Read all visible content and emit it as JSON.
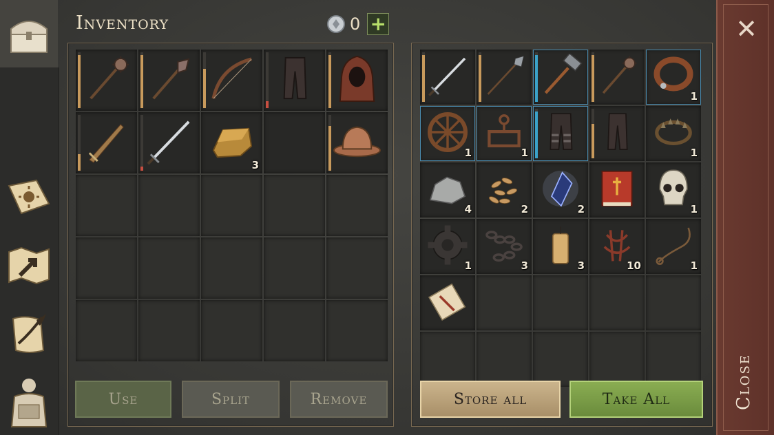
{
  "header": {
    "title": "Inventory",
    "currency_count": "0",
    "add_label": "+"
  },
  "sidebar": {
    "items": [
      {
        "icon": "chest-icon"
      },
      {
        "icon": "sun-book-icon"
      },
      {
        "icon": "map-icon"
      },
      {
        "icon": "scroll-quill-icon"
      },
      {
        "icon": "character-backpack-icon"
      }
    ]
  },
  "inventory": {
    "slots": [
      {
        "item": "mace-icon",
        "count": ""
      },
      {
        "item": "flanged-mace-icon",
        "count": ""
      },
      {
        "item": "bow-icon",
        "count": ""
      },
      {
        "item": "leather-pants-icon",
        "count": ""
      },
      {
        "item": "hood-icon",
        "count": ""
      },
      {
        "item": "short-sword-icon",
        "count": ""
      },
      {
        "item": "long-sword-icon",
        "count": ""
      },
      {
        "item": "gold-ingot-icon",
        "count": "3"
      },
      {
        "item": "",
        "count": ""
      },
      {
        "item": "kettle-helmet-icon",
        "count": ""
      }
    ]
  },
  "storage": {
    "slots": [
      {
        "item": "long-sword-icon",
        "count": ""
      },
      {
        "item": "halberd-icon",
        "count": ""
      },
      {
        "item": "hammer-icon",
        "count": ""
      },
      {
        "item": "mace-icon",
        "count": ""
      },
      {
        "item": "collar-icon",
        "count": "1"
      },
      {
        "item": "wheel-icon",
        "count": "1"
      },
      {
        "item": "anchor-frame-icon",
        "count": "1"
      },
      {
        "item": "plated-pants-icon",
        "count": ""
      },
      {
        "item": "leather-pants-icon",
        "count": ""
      },
      {
        "item": "bear-trap-icon",
        "count": "1"
      },
      {
        "item": "stone-icon",
        "count": "4"
      },
      {
        "item": "seeds-icon",
        "count": "2"
      },
      {
        "item": "crystal-icon",
        "count": "2"
      },
      {
        "item": "red-book-icon",
        "count": ""
      },
      {
        "item": "skull-icon",
        "count": "1"
      },
      {
        "item": "gear-icon",
        "count": "1"
      },
      {
        "item": "chain-icon",
        "count": "3"
      },
      {
        "item": "candle-icon",
        "count": "3"
      },
      {
        "item": "roots-icon",
        "count": "10"
      },
      {
        "item": "rope-icon",
        "count": "1"
      },
      {
        "item": "scroll-icon",
        "count": ""
      }
    ]
  },
  "buttons": {
    "use": "Use",
    "split": "Split",
    "remove": "Remove",
    "store_all": "Store all",
    "take_all": "Take All",
    "close": "Close",
    "close_x": "✕"
  },
  "colors": {
    "accent_green": "#7ea24a",
    "tan": "#c2aa82",
    "close_red": "#6a3a30",
    "durability": "#c89a5c",
    "low_durability": "#c74f41",
    "selected_blue": "#3ba2c8"
  }
}
